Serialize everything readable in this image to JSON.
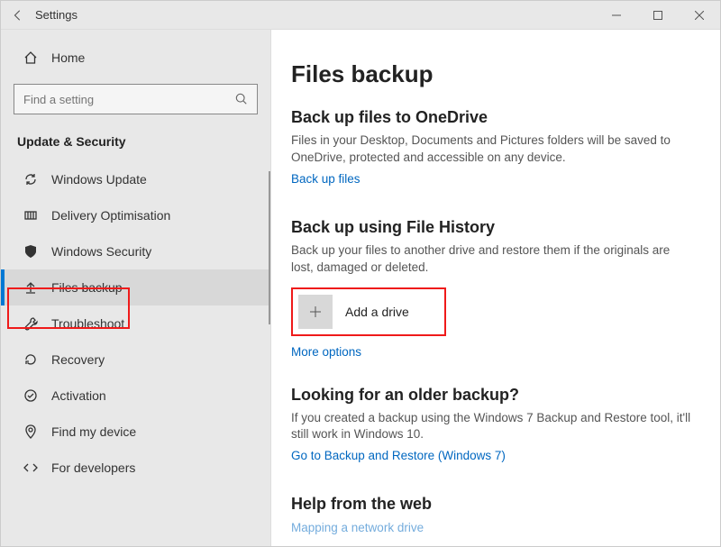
{
  "titlebar": {
    "title": "Settings"
  },
  "sidebar": {
    "home": "Home",
    "search_placeholder": "Find a setting",
    "section": "Update & Security",
    "items": [
      {
        "label": "Windows Update"
      },
      {
        "label": "Delivery Optimisation"
      },
      {
        "label": "Windows Security"
      },
      {
        "label": "Files backup"
      },
      {
        "label": "Troubleshoot"
      },
      {
        "label": "Recovery"
      },
      {
        "label": "Activation"
      },
      {
        "label": "Find my device"
      },
      {
        "label": "For developers"
      }
    ]
  },
  "main": {
    "title": "Files backup",
    "onedrive": {
      "heading": "Back up files to OneDrive",
      "desc": "Files in your Desktop, Documents and Pictures folders will be saved to OneDrive, protected and accessible on any device.",
      "link": "Back up files"
    },
    "history": {
      "heading": "Back up using File History",
      "desc": "Back up your files to another drive and restore them if the originals are lost, damaged or deleted.",
      "add_drive": "Add a drive",
      "more": "More options"
    },
    "older": {
      "heading": "Looking for an older backup?",
      "desc": "If you created a backup using the Windows 7 Backup and Restore tool, it'll still work in Windows 10.",
      "link": "Go to Backup and Restore (Windows 7)"
    },
    "help": {
      "heading": "Help from the web",
      "link": "Mapping a network drive"
    }
  }
}
